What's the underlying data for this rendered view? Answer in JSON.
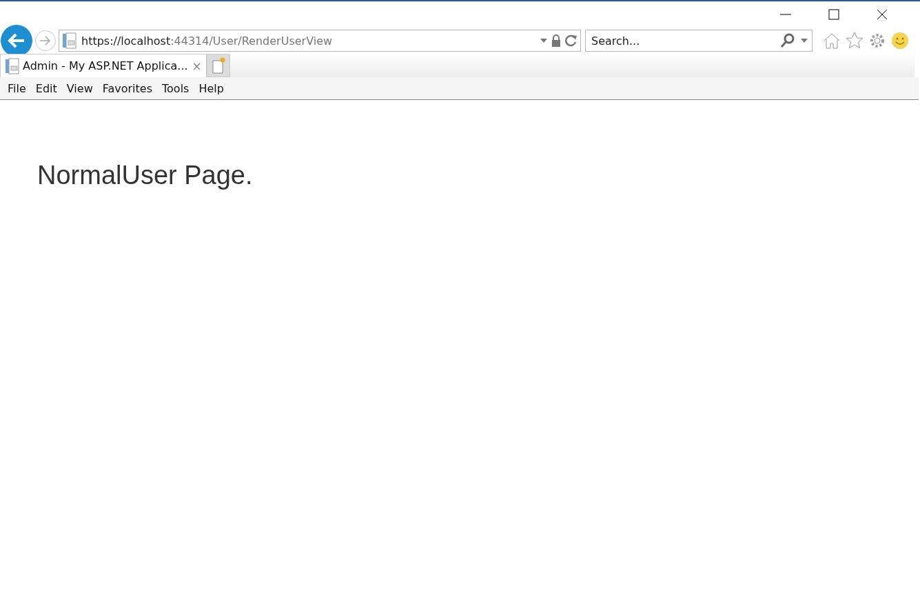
{
  "address_bar": {
    "host": "https://localhost",
    "path": ":44314/User/RenderUserView"
  },
  "search": {
    "placeholder": "Search..."
  },
  "tabs": [
    {
      "label": "Admin - My ASP.NET Applica...",
      "selected": true,
      "close": "×"
    }
  ],
  "menu": [
    "File",
    "Edit",
    "View",
    "Favorites",
    "Tools",
    "Help"
  ],
  "page": {
    "heading": "NormalUser Page."
  }
}
